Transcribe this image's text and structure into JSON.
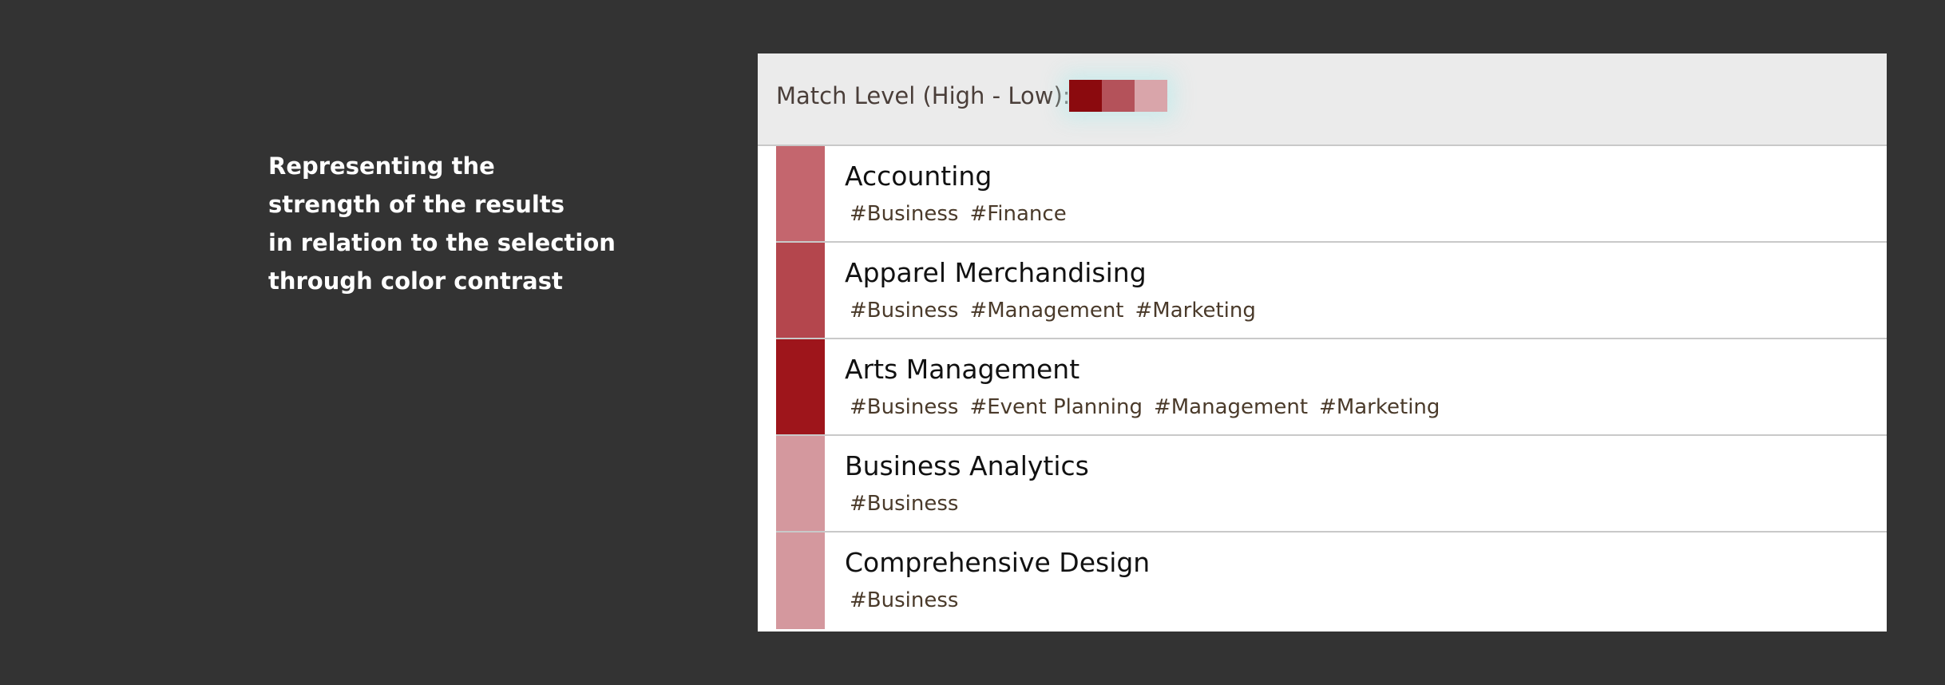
{
  "caption": {
    "lines": [
      "Representing the",
      "strength of the results",
      "in relation to the selection",
      "through color contrast"
    ]
  },
  "legend": {
    "label": "Match Level (High - Low):",
    "colors": [
      "#8b0a0e",
      "#b4525a",
      "#d9a5aa"
    ]
  },
  "results": [
    {
      "title": "Accounting",
      "tags": [
        "#Business",
        "#Finance"
      ],
      "color": "#c4666e"
    },
    {
      "title": "Apparel Merchandising",
      "tags": [
        "#Business",
        "#Management",
        "#Marketing"
      ],
      "color": "#b4464d"
    },
    {
      "title": "Arts Management",
      "tags": [
        "#Business",
        "#Event Planning",
        "#Management",
        "#Marketing"
      ],
      "color": "#9e151b"
    },
    {
      "title": "Business Analytics",
      "tags": [
        "#Business"
      ],
      "color": "#d4989e"
    },
    {
      "title": "Comprehensive Design",
      "tags": [
        "#Business"
      ],
      "color": "#d4989e"
    }
  ]
}
